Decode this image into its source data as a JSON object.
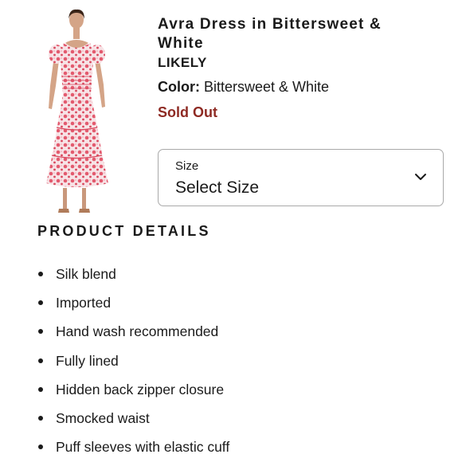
{
  "product": {
    "title": "Avra Dress in Bittersweet & White",
    "brand": "LIKELY",
    "color_label": "Color:",
    "color_value": "Bittersweet & White",
    "status": "Sold Out",
    "image_alt": "dress-photo"
  },
  "size_selector": {
    "label": "Size",
    "value": "Select Size",
    "icon": "chevron-down-icon"
  },
  "details": {
    "heading": "PRODUCT DETAILS",
    "items": [
      "Silk blend",
      "Imported",
      "Hand wash recommended",
      "Fully lined",
      "Hidden back zipper closure",
      "Smocked waist",
      "Puff sleeves with elastic cuff"
    ]
  },
  "colors": {
    "text": "#1a1a1a",
    "sold_out": "#8e2a23",
    "dress_pink": "#e35a6e",
    "border": "#a9a9a9"
  }
}
